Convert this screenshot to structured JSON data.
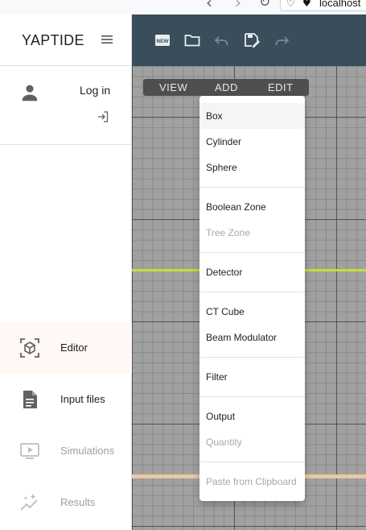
{
  "browser": {
    "url": "localhost"
  },
  "sidebar": {
    "brand": "YAPTIDE",
    "login": "Log in",
    "nav": [
      {
        "label": "Editor",
        "icon": "editor-cube-icon",
        "state": "active"
      },
      {
        "label": "Input files",
        "icon": "document-icon",
        "state": "enabled"
      },
      {
        "label": "Simulations",
        "icon": "play-screen-icon",
        "state": "disabled"
      },
      {
        "label": "Results",
        "icon": "sparkle-chart-icon",
        "state": "disabled"
      }
    ]
  },
  "toolbar": {
    "icons": [
      "new-icon",
      "folder-icon",
      "undo-icon",
      "save-edit-icon",
      "redo-icon"
    ],
    "new_badge": "NEW"
  },
  "menubar": {
    "view": "VIEW",
    "add": "ADD",
    "edit": "EDIT"
  },
  "add_menu": {
    "items": [
      {
        "label": "Box",
        "disabled": false,
        "highlighted": true
      },
      {
        "label": "Cylinder",
        "disabled": false
      },
      {
        "label": "Sphere",
        "disabled": false
      },
      {
        "label": "Boolean Zone",
        "disabled": false
      },
      {
        "label": "Tree Zone",
        "disabled": true
      },
      {
        "label": "Detector",
        "disabled": false
      },
      {
        "label": "CT Cube",
        "disabled": false
      },
      {
        "label": "Beam Modulator",
        "disabled": false
      },
      {
        "label": "Filter",
        "disabled": false
      },
      {
        "label": "Output",
        "disabled": false
      },
      {
        "label": "Quantity",
        "disabled": true
      },
      {
        "label": "Paste from Clipboard",
        "disabled": true
      }
    ]
  },
  "colors": {
    "topbar": "#3a4d5a",
    "grid_background": "#a1a1a1",
    "axis_green": "#bde236",
    "axis_tan": "#e9c9a5",
    "active_nav": "#fff8f4"
  }
}
